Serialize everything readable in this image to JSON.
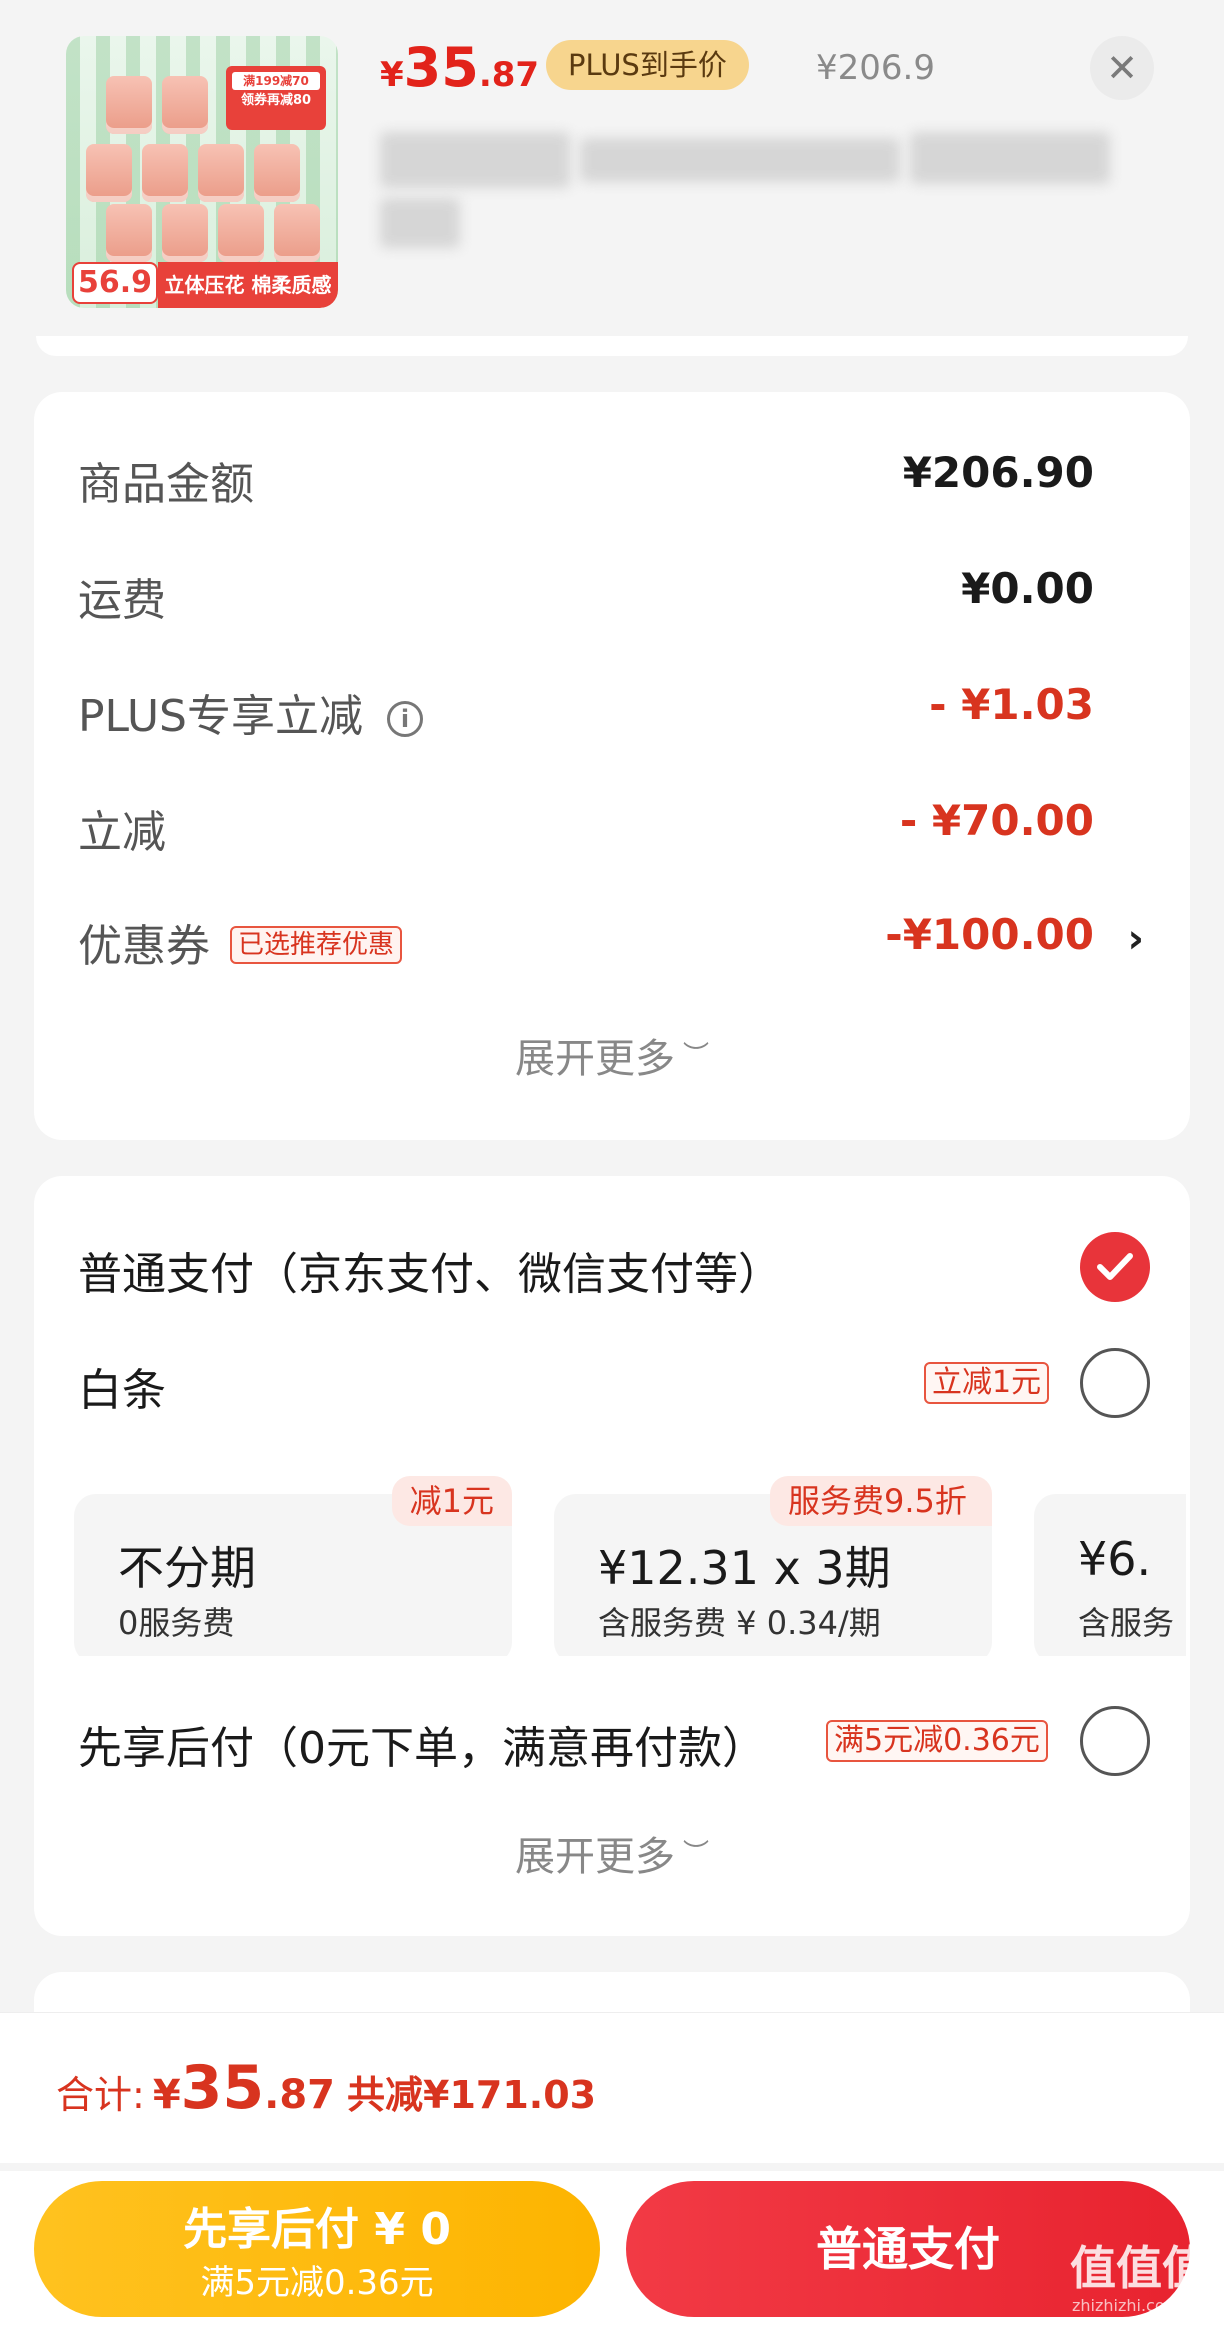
{
  "product": {
    "image": {
      "badge_top": "满199减70",
      "badge_bottom": "领券再减80",
      "promo_price": "56.9",
      "strip_text": "立体压花 棉柔质感"
    },
    "price_currency": "¥",
    "price_integer": "35",
    "price_decimal": ".87",
    "plus_tag": "PLUS到手价",
    "original_price": "¥206.9",
    "close_label": "✕"
  },
  "amounts": {
    "rows": [
      {
        "label": "商品金额",
        "value": "¥206.90"
      },
      {
        "label": "运费",
        "value": "¥0.00"
      },
      {
        "label": "PLUS专享立减",
        "value": "- ¥1.03"
      },
      {
        "label": "立减",
        "value": "- ¥70.00"
      },
      {
        "label": "优惠券",
        "value": "-¥100.00",
        "tag": "已选推荐优惠"
      }
    ],
    "info_icon": "i",
    "expand_label": "展开更多",
    "colors": {
      "discount": "#d8341f"
    }
  },
  "payment": {
    "normal": {
      "label": "普通支付（京东支付、微信支付等）",
      "selected": true
    },
    "baitiao": {
      "label": "白条",
      "promo": "立减1元",
      "selected": false,
      "plans": [
        {
          "badge": "减1元",
          "title": "不分期",
          "sub": "0服务费"
        },
        {
          "badge": "服务费9.5折",
          "title": "¥12.31 x 3期",
          "sub": "含服务费 ¥ 0.34/期"
        },
        {
          "badge": "",
          "title": "¥6.",
          "sub": "含服务"
        }
      ]
    },
    "paylater": {
      "label": "先享后付（0元下单，满意再付款）",
      "promo": "满5元减0.36元",
      "selected": false
    },
    "expand_label": "展开更多"
  },
  "footer": {
    "total_label": "合计:",
    "total_currency": "¥",
    "total_integer": "35",
    "total_decimal": ".87",
    "total_saving": "共减¥171.03",
    "btn_later_title": "先享后付 ¥ 0",
    "btn_later_sub": "满5元减0.36元",
    "btn_normal": "普通支付",
    "colors": {
      "accent": "#e2231a",
      "later_btn": "#fdb400",
      "pay_btn": "#e8232f"
    }
  },
  "watermark": {
    "main": "值值值",
    "sub": "zhizhizhi.com"
  }
}
